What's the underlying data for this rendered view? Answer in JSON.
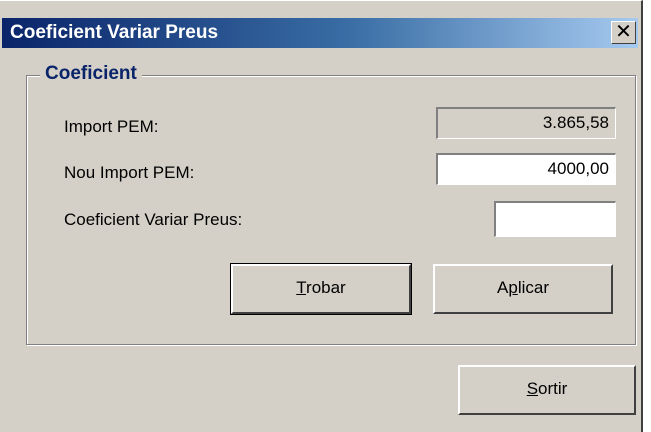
{
  "window": {
    "title": "Coeficient Variar Preus",
    "close_glyph": "✕",
    "close_icon": "close-icon"
  },
  "group": {
    "legend": "Coeficient"
  },
  "fields": {
    "import_pem": {
      "label": "Import PEM:",
      "value": "3.865,58"
    },
    "nou_import_pem": {
      "label": "Nou Import PEM:",
      "value": "4000,00"
    },
    "coeficient": {
      "label": "Coeficient Variar Preus:",
      "value": ""
    }
  },
  "buttons": {
    "trobar": {
      "mnemonic": "T",
      "rest": "robar"
    },
    "aplicar": {
      "pre": "A",
      "mnemonic": "p",
      "rest": "licar"
    },
    "sortir": {
      "mnemonic": "S",
      "rest": "ortir"
    }
  }
}
